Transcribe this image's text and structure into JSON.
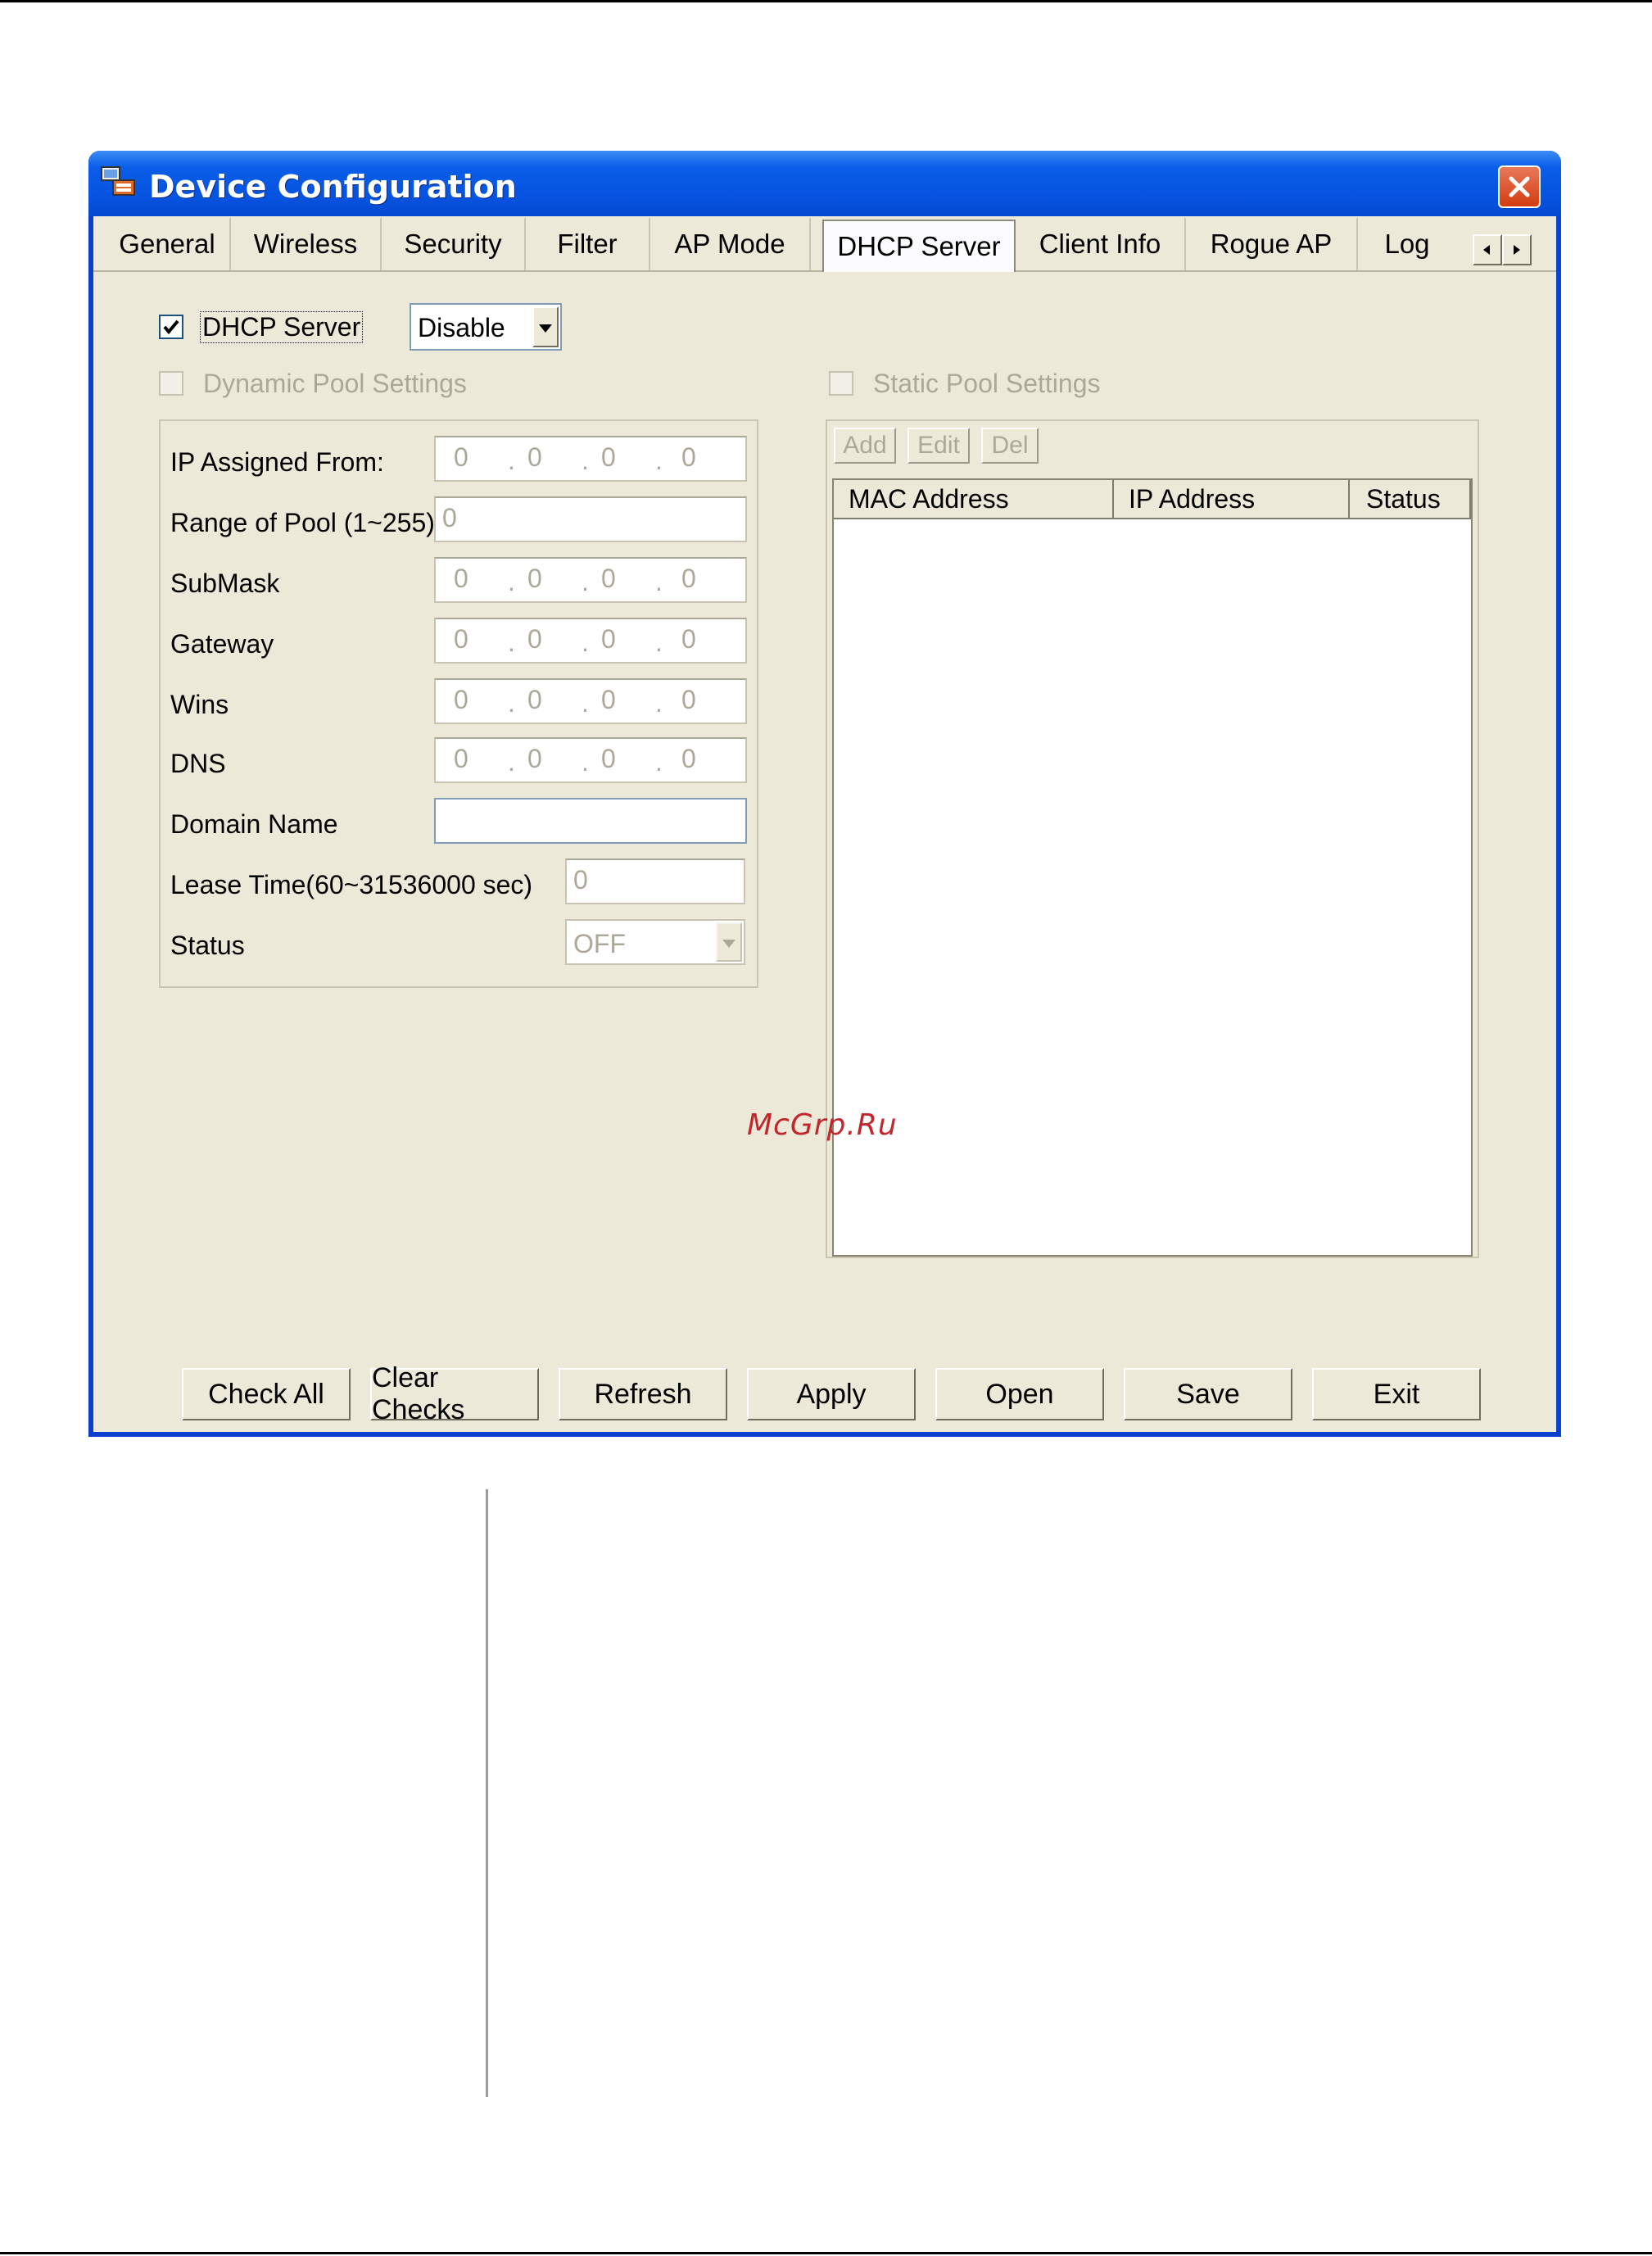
{
  "watermark": "McGrp.Ru",
  "window": {
    "title": "Device Configuration"
  },
  "tabs": [
    "General",
    "Wireless",
    "Security",
    "Filter",
    "AP Mode",
    "DHCP Server",
    "Client Info",
    "Rogue AP",
    "Log"
  ],
  "active_tab": "DHCP Server",
  "dhcp": {
    "checkbox_label": "DHCP Server",
    "checked": true,
    "mode_value": "Disable"
  },
  "dynamic_pool": {
    "label": "Dynamic Pool Settings",
    "fields": {
      "ip_assigned_from": "IP Assigned From:",
      "range_of_pool": "Range of Pool (1~255)",
      "submask": "SubMask",
      "gateway": "Gateway",
      "wins": "Wins",
      "dns": "DNS",
      "domain_name": "Domain Name",
      "lease_time": "Lease Time(60~31536000 sec)",
      "status": "Status"
    },
    "ip_value": [
      "0",
      "0",
      "0",
      "0"
    ],
    "range_value": "0",
    "lease_value": "0",
    "status_value": "OFF"
  },
  "static_pool": {
    "label": "Static Pool Settings",
    "buttons": {
      "add": "Add",
      "edit": "Edit",
      "del": "Del"
    },
    "columns": [
      "MAC Address",
      "IP Address",
      "Status"
    ]
  },
  "footer_buttons": [
    "Check All",
    "Clear Checks",
    "Refresh",
    "Apply",
    "Open",
    "Save",
    "Exit"
  ]
}
